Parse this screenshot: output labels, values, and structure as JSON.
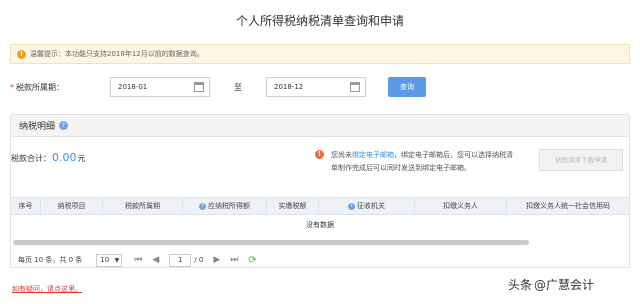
{
  "title": "个人所得税纳税清单查询和申请",
  "notice": {
    "icon": "warning-icon",
    "text": "温馨提示：本功能只支持2018年12月以前的数据查询。"
  },
  "query_form": {
    "period_label": "税款所属期：",
    "start_date": "2018-01",
    "to_label": "至",
    "end_date": "2018-12",
    "query_button": "查询"
  },
  "panel": {
    "title": "纳税明细",
    "total_label": "税款合计：",
    "total_amount": "0.00",
    "total_unit": "元",
    "email_tip": {
      "prefix": "您尚未",
      "link": "绑定电子邮箱",
      "suffix": "，绑定电子邮箱后，您可以选择纳税清单制作完成后可以同时发送到绑定电子邮箱。"
    },
    "apply_button": "纳税清单下载申请"
  },
  "table": {
    "columns": [
      "序号",
      "纳税项目",
      "税款所属期",
      "应纳税所得额",
      "实缴税额",
      "征收机关",
      "扣缴义务人",
      "扣缴义务人统一社会信用码"
    ],
    "empty_text": "没有数据"
  },
  "pager": {
    "summary": "每页 10 条，共 0 条",
    "page_size": "10",
    "current_page": "1",
    "total_pages": "/ 0"
  },
  "helper_link": "如有疑问，请点这里。",
  "watermark": {
    "source": "头条",
    "handle": "@广慧会计"
  },
  "colors": {
    "accent": "#3a8ee6",
    "button": "#5b9be6",
    "required": "#e03a3a",
    "notice_bg": "#fdf6e3"
  }
}
